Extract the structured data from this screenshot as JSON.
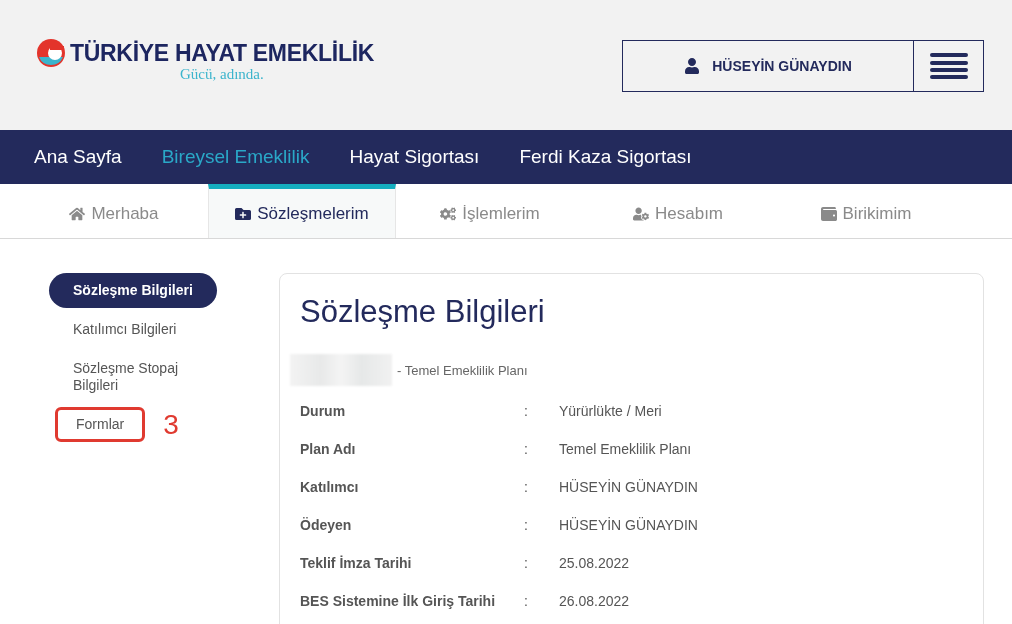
{
  "logo": {
    "name": "TÜRKİYE HAYAT EMEKLİLİK",
    "slogan": "Gücü, adında."
  },
  "user": {
    "name": "HÜSEYİN GÜNAYDIN"
  },
  "main_nav": [
    {
      "label": "Ana Sayfa",
      "selected": false
    },
    {
      "label": "Bireysel Emeklilik",
      "selected": true
    },
    {
      "label": "Hayat Sigortası",
      "selected": false
    },
    {
      "label": "Ferdi Kaza Sigortası",
      "selected": false
    }
  ],
  "sub_tabs": [
    {
      "label": "Merhaba",
      "kind": "home",
      "selected": false
    },
    {
      "label": "Sözleşmelerim",
      "kind": "folder",
      "selected": true
    },
    {
      "label": "İşlemlerim",
      "kind": "gears",
      "selected": false
    },
    {
      "label": "Hesabım",
      "kind": "user-gear",
      "selected": false
    },
    {
      "label": "Birikimim",
      "kind": "wallet",
      "selected": false
    }
  ],
  "sidebar": {
    "items": [
      {
        "label": "Sözleşme Bilgileri",
        "selected": true,
        "annotated": false
      },
      {
        "label": "Katılımcı Bilgileri",
        "selected": false,
        "annotated": false
      },
      {
        "label": "Sözleşme Stopaj Bilgileri",
        "selected": false,
        "annotated": false
      },
      {
        "label": "Formlar",
        "selected": false,
        "annotated": true
      }
    ],
    "annotation_number": "3"
  },
  "card": {
    "title": "Sözleşme Bilgileri",
    "subtitle": "- Temel Emeklilik Planı",
    "rows": [
      {
        "label": "Durum",
        "separator": ":",
        "value": "Yürürlükte / Meri"
      },
      {
        "label": "Plan Adı",
        "separator": ":",
        "value": "Temel Emeklilik Planı"
      },
      {
        "label": "Katılımcı",
        "separator": ":",
        "value": "HÜSEYİN GÜNAYDIN"
      },
      {
        "label": "Ödeyen",
        "separator": ":",
        "value": "HÜSEYİN GÜNAYDIN"
      },
      {
        "label": "Teklif İmza Tarihi",
        "separator": ":",
        "value": "25.08.2022"
      },
      {
        "label": "BES Sistemine İlk Giriş Tarihi",
        "separator": ":",
        "value": "26.08.2022"
      }
    ]
  }
}
